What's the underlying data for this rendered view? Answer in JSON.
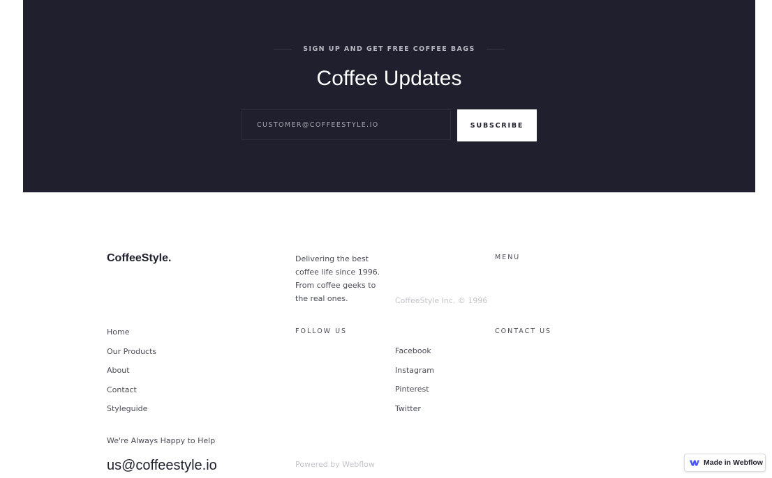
{
  "newsletter": {
    "eyebrow": "SIGN UP AND GET FREE COFFEE BAGS",
    "title": "Coffee Updates",
    "email_placeholder": "CUSTOMER@COFFEESTYLE.IO",
    "subscribe_label": "SUBSCRIBE"
  },
  "footer": {
    "brand": "CoffeeStyle.",
    "tagline": "Delivering the best coffee life since 1996. From coffee geeks to the real ones.",
    "copyright": "CoffeeStyle Inc. © 1996",
    "menu_heading": "MENU",
    "follow_heading": "FOLLOW US",
    "contact_heading": "CONTACT US",
    "nav_links": [
      "Home",
      "Our Products",
      "About",
      "Contact",
      "Styleguide"
    ],
    "social_links": [
      "Facebook",
      "Instagram",
      "Pinterest",
      "Twitter"
    ],
    "help_text": "We're Always Happy to Help",
    "email": "us@coffeestyle.io",
    "powered_by": "Powered by Webflow"
  },
  "badge": {
    "label": "Made in Webflow",
    "icon": "webflow-logo-icon",
    "icon_color": "#4353ff"
  }
}
